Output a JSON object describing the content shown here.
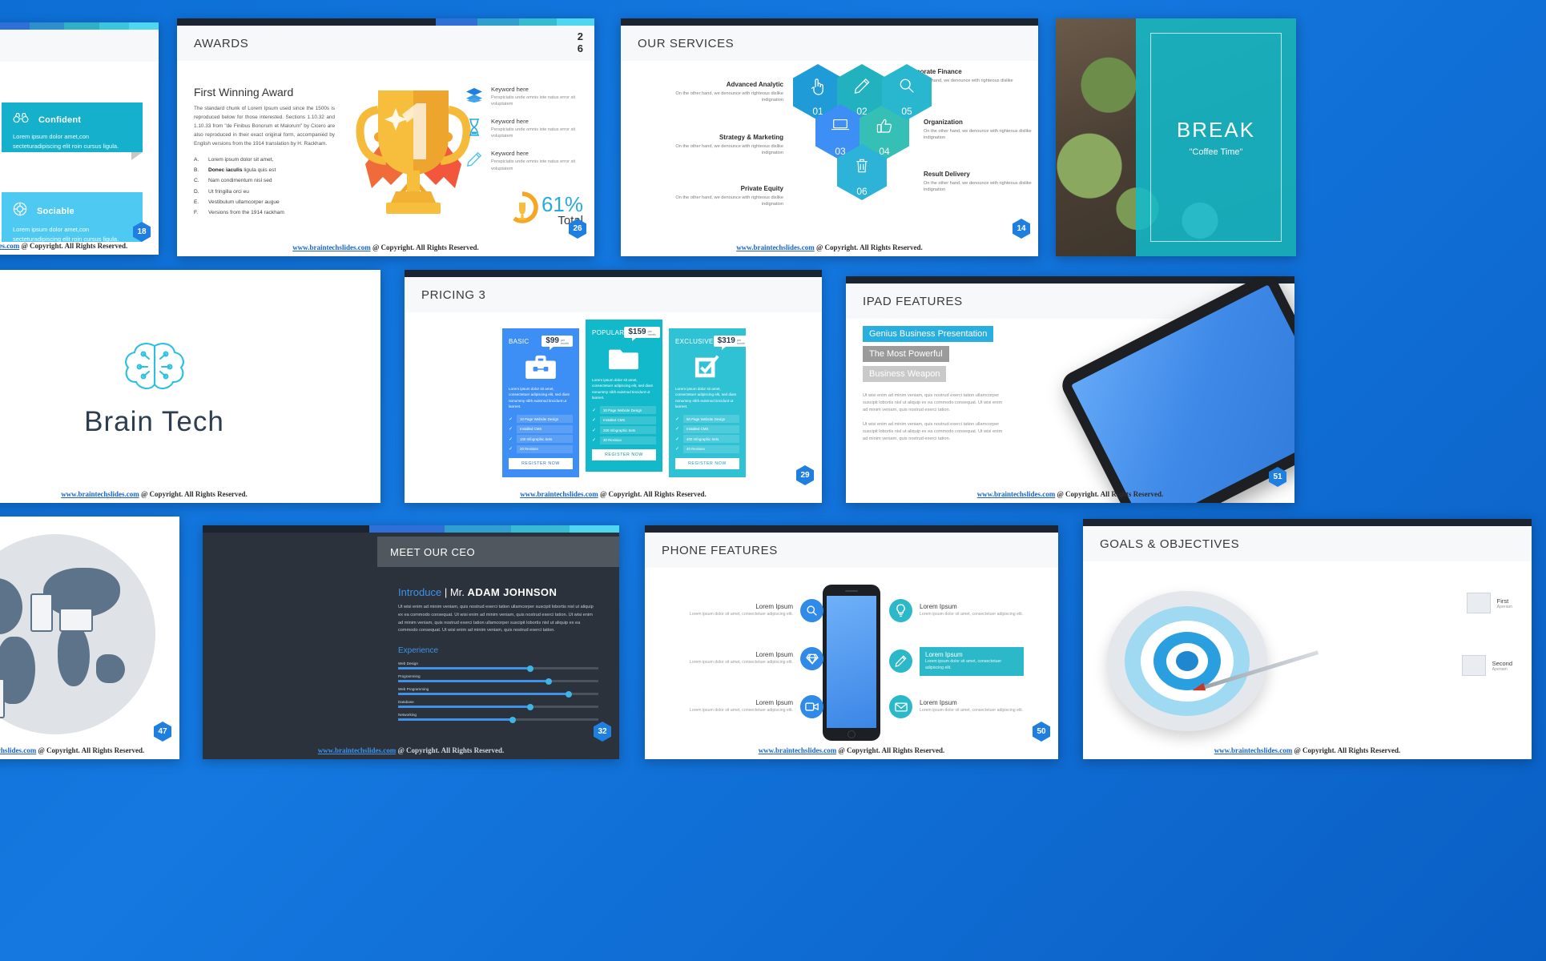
{
  "deck": {
    "site": "www.braintechslides.com",
    "copyright": " @ Copyright. All Rights Reserved.",
    "accent_blue": "#1f7fe0",
    "accent_teal": "#12b9cb",
    "background": "#0d6fd6"
  },
  "slide_traits": {
    "items": [
      {
        "icon": "binoculars-icon",
        "title": "Confident",
        "body": "Lorem ipsum dolor amet,con secteturadipiscing elit roin cursus ligula.",
        "color": "#14b0cc"
      },
      {
        "icon": "lifebuoy-icon",
        "title": "Sociable",
        "body": "Lorem ipsum dolor amet,con secteturadipiscing elit roin cursus ligula.",
        "color": "#4ecaf2"
      }
    ],
    "page": "18"
  },
  "slide_awards": {
    "title": "AWARDS",
    "page_big": [
      "2",
      "6"
    ],
    "heading": "First Winning Award",
    "paragraph": "The standard chunk of Lorem Ipsum used since the 1500s is reproduced below for those interested. Sections 1.10.32 and 1.10.33 from \"de Finibus Bonorum et Malorum\" by Cicero are also reproduced in their exact original form, accompanied by English versions from the 1914 translation by H. Rackham.",
    "list": [
      {
        "key": "A.",
        "text": "Lorem ipsum dolor sit amet,",
        "bold": ""
      },
      {
        "key": "B.",
        "text": "ligula quis est",
        "bold": "Donec iaculis"
      },
      {
        "key": "C.",
        "text": "Nam condimentum nisl sed",
        "bold": ""
      },
      {
        "key": "D.",
        "text": "Ut fringilla orci eu",
        "bold": ""
      },
      {
        "key": "E.",
        "text": "Vestibulum ullamcorper augue",
        "bold": ""
      },
      {
        "key": "F.",
        "text": "Versions from the 1914 rackham",
        "bold": ""
      }
    ],
    "keywords": [
      {
        "icon": "layers-icon",
        "title": "Keyword here",
        "desc": "Perspiciatis unde omnis iste natus error sit voluptatem"
      },
      {
        "icon": "hourglass-icon",
        "title": "Keyword here",
        "desc": "Perspiciatis unde omnis iste natus error sit voluptatem"
      },
      {
        "icon": "pencil-icon",
        "title": "Keyword here",
        "desc": "Perspiciatis unde omnis iste natus error sit voluptatem"
      }
    ],
    "stat_value": "61%",
    "stat_label": "Total",
    "page": "26"
  },
  "slide_services": {
    "title": "OUR SERVICES",
    "hexes": [
      {
        "num": "01",
        "icon": "pointing-hand-icon",
        "color": "#1f9bd8"
      },
      {
        "num": "02",
        "icon": "pencil-icon",
        "color": "#22b2bf"
      },
      {
        "num": "03",
        "icon": "laptop-icon",
        "color": "#3d8ef5"
      },
      {
        "num": "04",
        "icon": "thumbs-up-icon",
        "color": "#36bfb4"
      },
      {
        "num": "05",
        "icon": "magnifier-icon",
        "color": "#29b6cf"
      },
      {
        "num": "06",
        "icon": "trash-icon",
        "color": "#2db2d8"
      }
    ],
    "labels": [
      {
        "title": "Advanced Analytic",
        "desc": "On the other hand, we denounce with righteous dislike indignation",
        "side": "left"
      },
      {
        "title": "Strategy & Marketing",
        "desc": "On the other hand, we denounce with righteous dislike indignation",
        "side": "left"
      },
      {
        "title": "Private Equity",
        "desc": "On the other hand, we denounce with righteous dislike indignation",
        "side": "left"
      },
      {
        "title": "Corporate Finance",
        "desc": "On the other hand, we denounce with righteous dislike indignation",
        "side": "right"
      },
      {
        "title": "Organization",
        "desc": "On the other hand, we denounce with righteous dislike indignation",
        "side": "right"
      },
      {
        "title": "Result Delivery",
        "desc": "On the other hand, we denounce with righteous dislike indignation",
        "side": "right"
      }
    ],
    "page": "14"
  },
  "slide_break": {
    "title": "BREAK",
    "subtitle": "\"Coffee Time\""
  },
  "slide_logo": {
    "name": "Brain Tech",
    "icon": "brain-circuit-icon"
  },
  "slide_pricing": {
    "title": "PRICING 3",
    "per_line1": "per",
    "per_line2": "month",
    "cards": [
      {
        "name": "BASIC",
        "price": "$99",
        "icon": "briefcase-icon",
        "desc": "Lorem ipsum dolor sit amet, consectetuer adipiscing elit, sed diam nonummy nibh euismod tincidunt ut laoreet.",
        "features": [
          "10 Page Website Design",
          "Installed CMS",
          "100 Infographic Sets",
          "20 Revision"
        ],
        "button": "REGISTER NOW"
      },
      {
        "name": "POPULAR",
        "price": "$159",
        "icon": "folder-icon",
        "desc": "Lorem ipsum dolor sit amet, consectetuer adipiscing elit, sed diam nonummy nibh euismod tincidunt ut laoreet.",
        "features": [
          "30 Page Website Design",
          "Installed CMS",
          "200 Infographic Sets",
          "30 Revision"
        ],
        "button": "REGISTER NOW"
      },
      {
        "name": "EXCLUSIVE",
        "price": "$319",
        "icon": "checkbox-icon",
        "desc": "Lorem ipsum dolor sit amet, consectetuer adipiscing elit, sed diam nonummy nibh euismod tincidunt ut laoreet.",
        "features": [
          "50 Page Website Design",
          "Installed CMS",
          "400 Infographic Sets",
          "40 Revision"
        ],
        "button": "REGISTER NOW"
      }
    ],
    "page": "29"
  },
  "slide_ipad": {
    "title": "IPAD FEATURES",
    "tags": [
      "Genius Business Presentation",
      "The Most Powerful",
      "Business Weapon"
    ],
    "paragraphs": [
      "Ut wisi enim ad minim veniam, quis nostrud exerci tation ullamcorper suscipit lobortis nisl ut aliquip ex ea commodo consequat. Ut wisi enim ad minim veniam, quis nostrud exerci tation.",
      "Ut wisi enim ad minim veniam, quis nostrud exerci tation ullamcorper suscipit lobortis nisl ut aliquip ex ea commodo consequat. Ut wisi enim ad minim veniam, quis nostrud exerci tation."
    ],
    "page": "51"
  },
  "slide_world": {
    "page": "47",
    "icon": "globe-devices-icon"
  },
  "slide_ceo": {
    "title": "MEET OUR CEO",
    "intro_label": "Introduce",
    "separator": "|",
    "honorific": "Mr.",
    "name": "ADAM JOHNSON",
    "bio": "Ut wisi enim ad minim veniam, quis nostrud exerci tation ullamcorper suscipit lobortis nisl ut aliquip ex ea commodo consequat. Ut wisi enim ad minim veniam, quis nostrud exerci tation. Ut wisi enim ad minim veniam, quis nostrud exerci tation ullamcorper suscipit lobortis nisl ut aliquip ex ea commodo consequat. Ut wisi enim ad minim veniam, quis nostrud exerci tation.",
    "experience_heading": "Experience",
    "skills": [
      {
        "label": "Web Design",
        "value": 66
      },
      {
        "label": "Programming",
        "value": 75
      },
      {
        "label": "Web Programming",
        "value": 85
      },
      {
        "label": "Database",
        "value": 66
      },
      {
        "label": "Networking",
        "value": 57
      }
    ],
    "page": "32"
  },
  "slide_phone": {
    "title": "PHONE FEATURES",
    "features_left": [
      {
        "icon": "magnifier-icon",
        "title": "Lorem Ipsum",
        "desc": "Lorem ipsum dolor sit amet, consectetuer adipiscing elit.",
        "color": "blue"
      },
      {
        "icon": "diamond-icon",
        "title": "Lorem Ipsum",
        "desc": "Lorem ipsum dolor sit amet, consectetuer adipiscing elit.",
        "color": "blue"
      },
      {
        "icon": "video-icon",
        "title": "Lorem Ipsum",
        "desc": "Lorem ipsum dolor sit amet, consectetuer adipiscing elit.",
        "color": "blue"
      }
    ],
    "features_right": [
      {
        "icon": "bulb-icon",
        "title": "Lorem Ipsum",
        "desc": "Lorem ipsum dolor sit amet, consectetuer adipiscing elit.",
        "color": "teal",
        "highlight": false
      },
      {
        "icon": "pencil-icon",
        "title": "Lorem Ipsum",
        "desc": "Lorem ipsum dolor sit amet, consectetuer adipiscing elit.",
        "color": "teal",
        "highlight": true
      },
      {
        "icon": "mail-icon",
        "title": "Lorem Ipsum",
        "desc": "Lorem ipsum dolor sit amet, consectetuer adipiscing elit.",
        "color": "teal",
        "highlight": false
      }
    ],
    "page": "50"
  },
  "slide_goals": {
    "title": "GOALS & OBJECTIVES",
    "items": [
      {
        "title": "First",
        "desc": "Aperiam"
      },
      {
        "title": "Second",
        "desc": "Aperiam"
      }
    ]
  }
}
